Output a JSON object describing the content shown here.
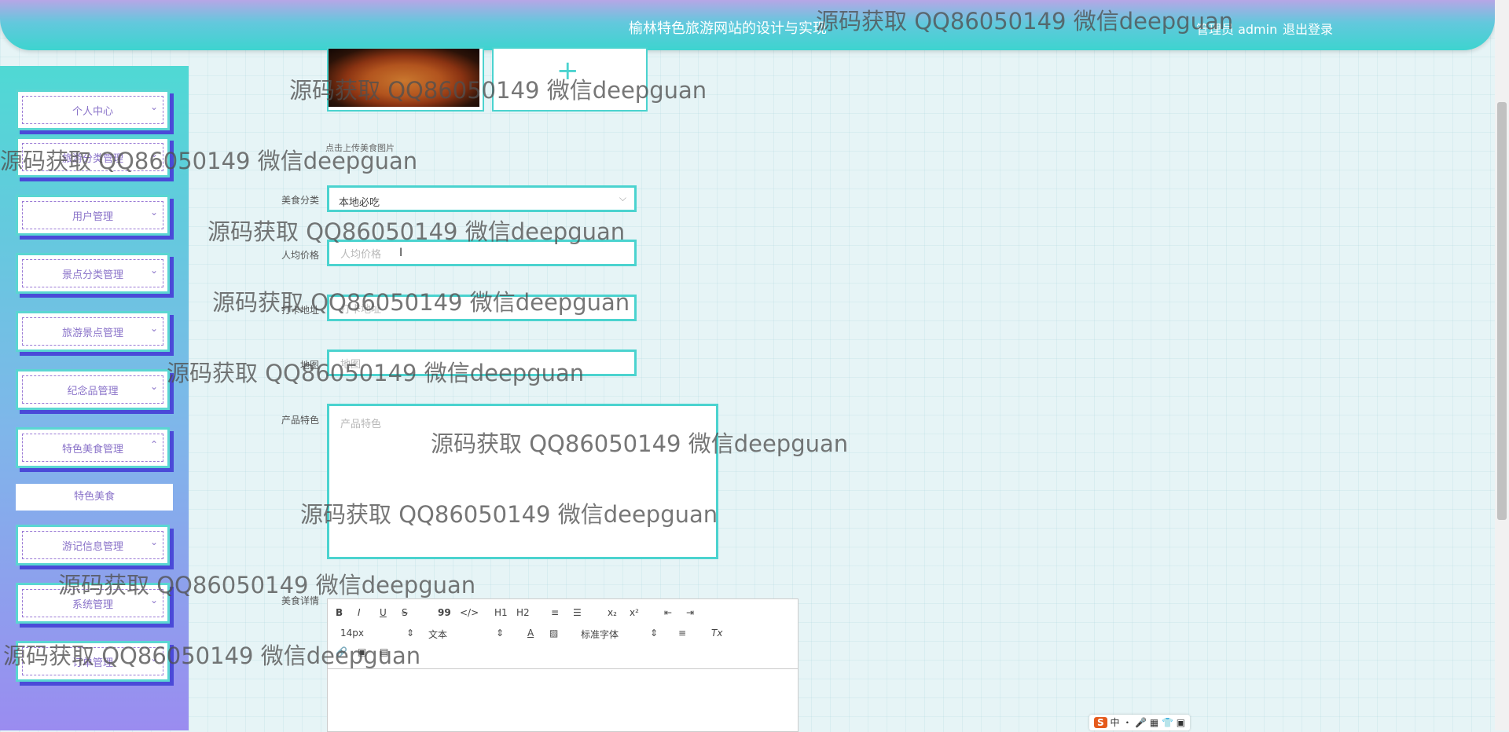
{
  "header": {
    "title": "榆林特色旅游网站的设计与实现",
    "user_label": "管理员 admin",
    "logout_label": "退出登录"
  },
  "sidebar": {
    "items": [
      {
        "label": "个人中心",
        "chevron": "chevron-down"
      },
      {
        "label": "旅游分类管理",
        "chevron": "chevron-down"
      },
      {
        "label": "用户管理",
        "chevron": "chevron-down"
      },
      {
        "label": "景点分类管理",
        "chevron": "chevron-down"
      },
      {
        "label": "旅游景点管理",
        "chevron": "chevron-down"
      },
      {
        "label": "纪念品管理",
        "chevron": "chevron-down"
      },
      {
        "label": "特色美食管理",
        "chevron": "chevron-up"
      },
      {
        "label": "游记信息管理",
        "chevron": "chevron-down"
      },
      {
        "label": "系统管理",
        "chevron": "chevron-down"
      },
      {
        "label": "订单管理",
        "chevron": "chevron-down"
      }
    ],
    "active_sub": "特色美食",
    "chev_down": "⌄",
    "chev_up": "⌃"
  },
  "form": {
    "upload_hint": "点击上传美食图片",
    "upload_plus": "+",
    "category_label": "美食分类",
    "category_value": "本地必吃",
    "category_arrow": "⌵",
    "price_label": "人均价格",
    "price_placeholder": "人均价格",
    "address_label": "打卡地址",
    "address_placeholder": "打卡地址",
    "map_label": "地图",
    "map_placeholder": "地图",
    "feature_label": "产品特色",
    "feature_placeholder": "产品特色",
    "detail_label": "美食详情"
  },
  "editor": {
    "row1": [
      "B",
      "I",
      "U",
      "S",
      "99",
      "</>",
      "H1",
      "H2",
      "≡",
      "☰",
      "x₂",
      "x²",
      "⇤",
      "⇥"
    ],
    "font_size": "14px",
    "text_type": "文本",
    "font_family": "标准字体",
    "clear_format": "Tx",
    "row3": [
      "🔗",
      "▣",
      "▤"
    ]
  },
  "ime": {
    "logo": "S",
    "mode": "中"
  },
  "watermark": "源码获取 QQ86050149 微信deepguan",
  "colors": {
    "accent": "#4bd3cf",
    "menu_text": "#8a73c9",
    "menu_shadow": "#4a4ad8"
  }
}
